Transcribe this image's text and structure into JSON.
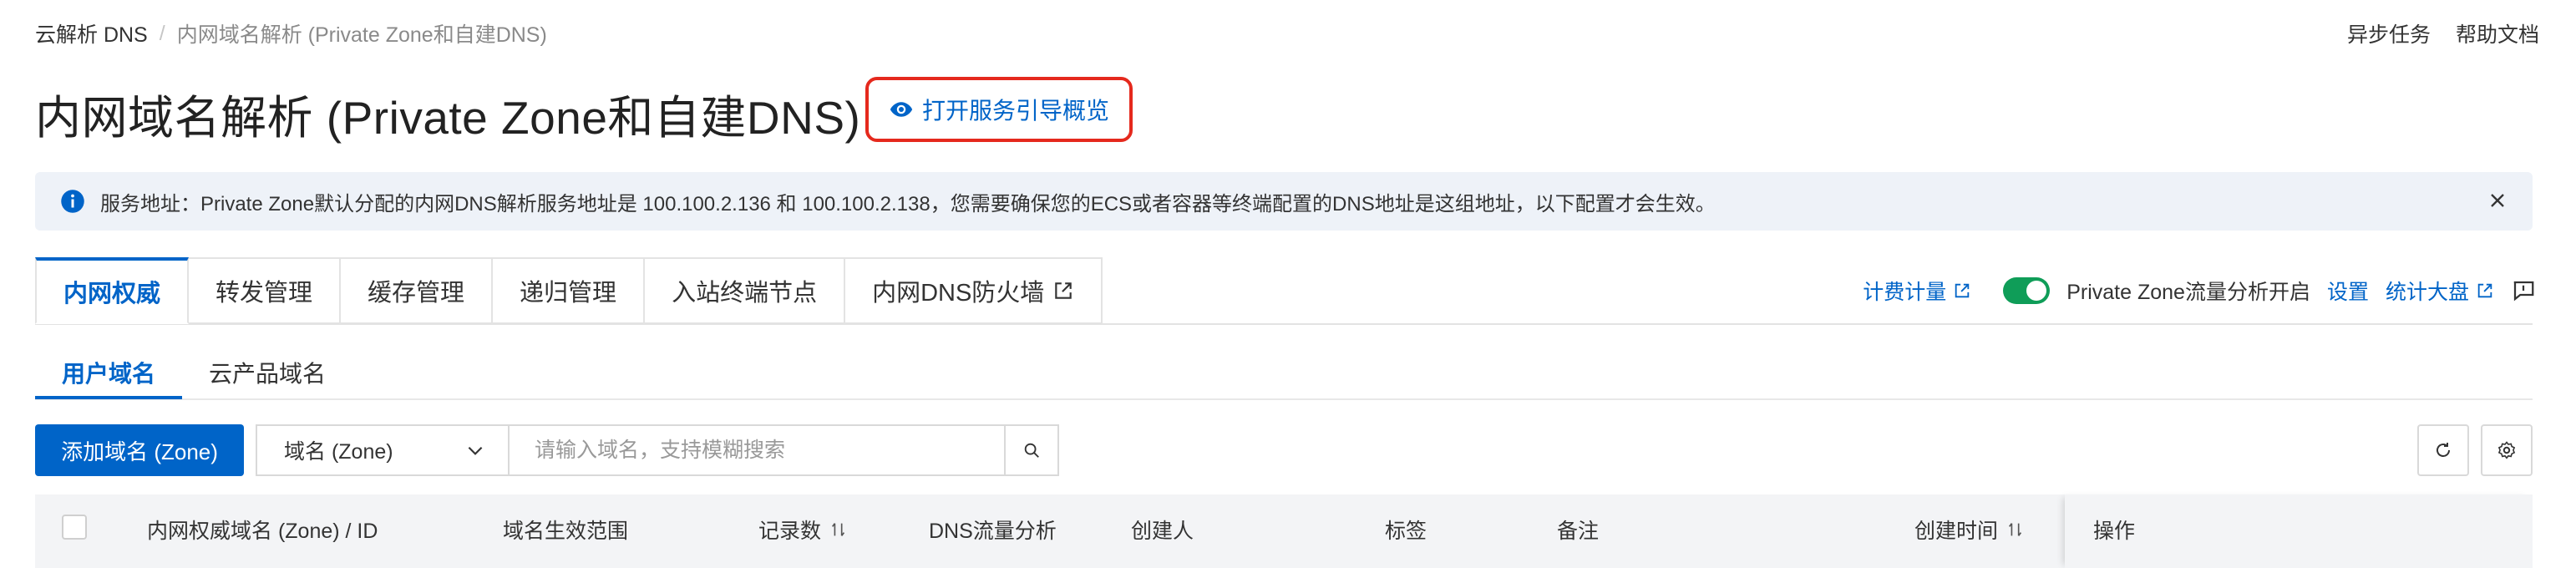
{
  "breadcrumb": {
    "root": "云解析 DNS",
    "separator": "/",
    "current": "内网域名解析 (Private Zone和自建DNS)"
  },
  "header_links": {
    "async_tasks": "异步任务",
    "help_docs": "帮助文档"
  },
  "page": {
    "title": "内网域名解析 (Private Zone和自建DNS)",
    "guide_label": "打开服务引导概览"
  },
  "alert": {
    "message": "服务地址：Private Zone默认分配的内网DNS解析服务地址是 100.100.2.136 和 100.100.2.138，您需要确保您的ECS或者容器等终端配置的DNS地址是这组地址，以下配置才会生效。"
  },
  "tabs": [
    {
      "label": "内网权威",
      "active": true
    },
    {
      "label": "转发管理"
    },
    {
      "label": "缓存管理"
    },
    {
      "label": "递归管理"
    },
    {
      "label": "入站终端节点"
    },
    {
      "label": "内网DNS防火墙",
      "external": true
    }
  ],
  "right_tools": {
    "billing": "计费计量",
    "toggle_label": "Private Zone流量分析开启",
    "toggle_on": true,
    "settings": "设置",
    "dashboard": "统计大盘"
  },
  "subtabs": [
    {
      "label": "用户域名",
      "active": true
    },
    {
      "label": "云产品域名"
    }
  ],
  "toolbar": {
    "add_button": "添加域名 (Zone)",
    "select_value": "域名 (Zone)",
    "search_placeholder": "请输入域名，支持模糊搜索"
  },
  "table": {
    "columns": {
      "zone": "内网权威域名 (Zone) / ID",
      "scope": "域名生效范围",
      "records": "记录数",
      "dns_analysis": "DNS流量分析",
      "creator": "创建人",
      "tags": "标签",
      "remark": "备注",
      "created": "创建时间",
      "actions": "操作"
    }
  },
  "colors": {
    "accent": "#0064c8",
    "highlight_border": "#e5291d",
    "toggle_on": "#0f9d58"
  }
}
